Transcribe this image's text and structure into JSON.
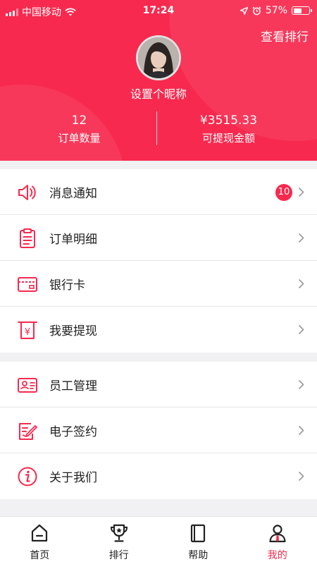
{
  "status_bar": {
    "carrier": "中国移动",
    "time": "17:24",
    "battery_text": "57%",
    "battery_level": 0.57
  },
  "header": {
    "rank_link": "查看排行",
    "nickname": "设置个昵称",
    "stats": [
      {
        "value": "12",
        "label": "订单数量"
      },
      {
        "value": "¥3515.33",
        "label": "可提现金额"
      }
    ]
  },
  "menu_group_1": [
    {
      "label": "消息通知",
      "icon": "speaker-icon",
      "badge": "10"
    },
    {
      "label": "订单明细",
      "icon": "clipboard-icon"
    },
    {
      "label": "银行卡",
      "icon": "bank-card-icon"
    },
    {
      "label": "我要提现",
      "icon": "withdraw-icon"
    }
  ],
  "menu_group_2": [
    {
      "label": "员工管理",
      "icon": "id-card-icon"
    },
    {
      "label": "电子签约",
      "icon": "sign-pen-icon"
    },
    {
      "label": "关于我们",
      "icon": "info-icon"
    }
  ],
  "tabbar": [
    {
      "label": "首页",
      "icon": "home-icon",
      "active": false
    },
    {
      "label": "排行",
      "icon": "trophy-icon",
      "active": false
    },
    {
      "label": "帮助",
      "icon": "book-icon",
      "active": false
    },
    {
      "label": "我的",
      "icon": "user-icon",
      "active": true
    }
  ],
  "colors": {
    "accent": "#f8294e",
    "background": "#f1f1f3"
  }
}
